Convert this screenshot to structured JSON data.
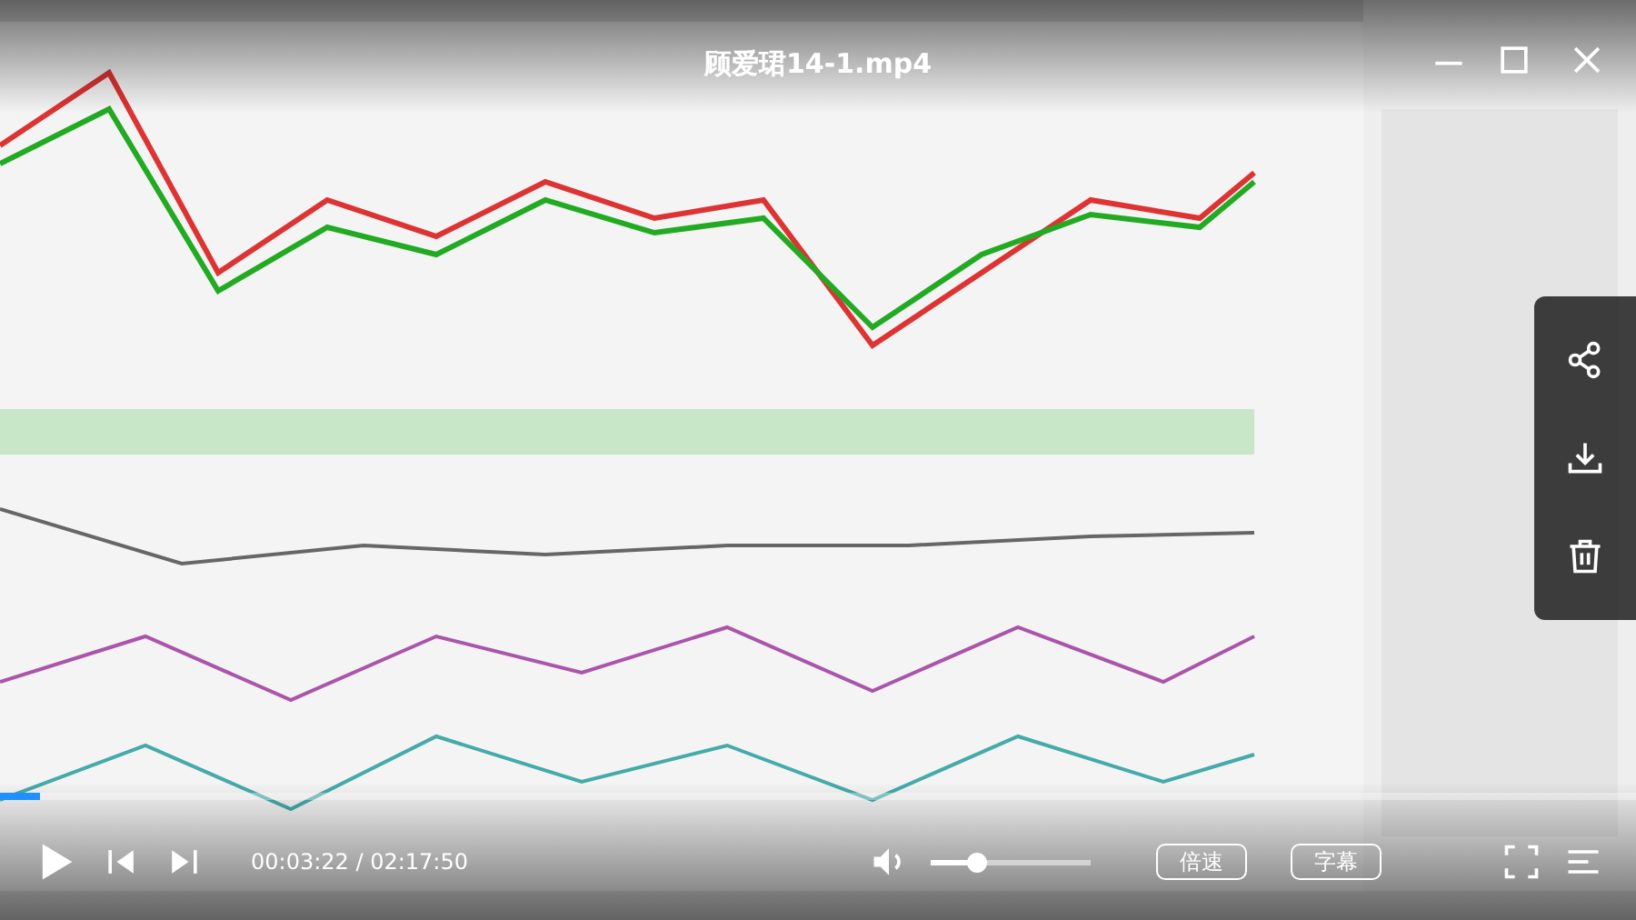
{
  "title": "顾爱珺14-1.mp4",
  "progress": {
    "level": 0.024
  },
  "time": "00:03:22 / 02:17:50",
  "volume": {
    "level": 0.28
  },
  "buttons": [
    "倍速",
    "字幕"
  ]
}
